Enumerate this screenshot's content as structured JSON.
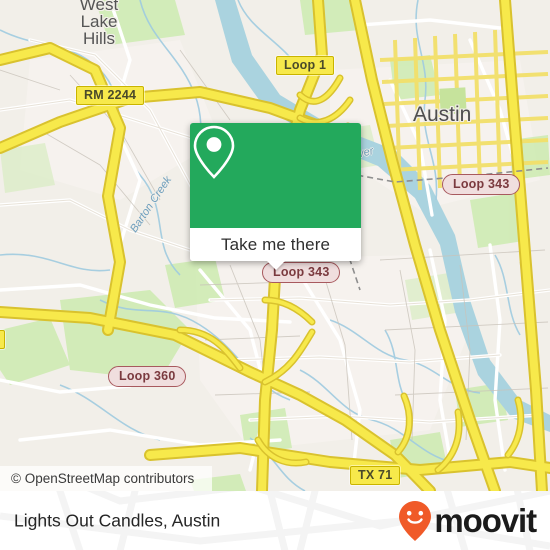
{
  "map": {
    "provider_attribution": "© OpenStreetMap contributors",
    "background_color": "#f2efe9",
    "road_color": "#f7e94b",
    "water_color": "#aad3df",
    "park_color": "#cdebb0",
    "place_labels": [
      {
        "name": "west-lake-hills",
        "text": "West\nLake\nHills",
        "lines": [
          "West",
          "Lake",
          "Hills"
        ]
      },
      {
        "name": "austin",
        "text": "Austin"
      }
    ],
    "water_labels": [
      {
        "name": "barton-creek",
        "text": "Barton Creek"
      },
      {
        "name": "colorado-river",
        "text": "River"
      }
    ],
    "shields": [
      {
        "name": "rm-2244",
        "text": "RM 2244",
        "style": "yellow"
      },
      {
        "name": "loop-1",
        "text": "Loop 1",
        "style": "yellow"
      },
      {
        "name": "tx-71",
        "text": "TX 71",
        "style": "yellow"
      },
      {
        "name": "loop-343-north",
        "text": "Loop 343",
        "style": "pink"
      },
      {
        "name": "loop-343-south",
        "text": "Loop 343",
        "style": "pink"
      },
      {
        "name": "loop-360",
        "text": "Loop 360",
        "style": "pink"
      }
    ]
  },
  "popup": {
    "accent_color": "#23a95c",
    "icon": "map-pin-icon",
    "button_label": "Take me there"
  },
  "footer": {
    "title": "Lights Out Candles, Austin",
    "brand": {
      "name": "moovit",
      "wordmark": "moovit",
      "pin_color": "#f05a28",
      "text_color": "#1b1b1b"
    }
  }
}
